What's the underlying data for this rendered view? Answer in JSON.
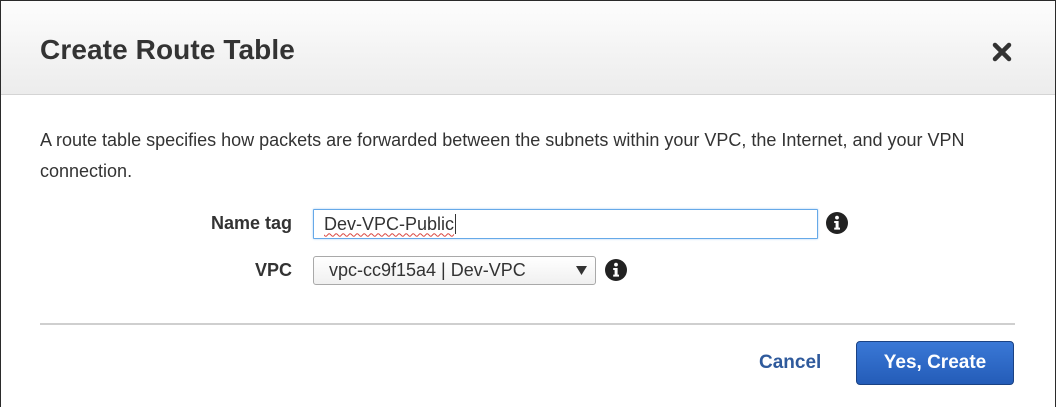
{
  "dialog": {
    "title": "Create Route Table",
    "close_icon": "close-icon",
    "description": "A route table specifies how packets are forwarded between the subnets within your VPC, the Internet, and your VPN connection."
  },
  "form": {
    "name_tag": {
      "label": "Name tag",
      "value": "Dev-VPC-Public",
      "info_icon": "info-icon"
    },
    "vpc": {
      "label": "VPC",
      "selected": "vpc-cc9f15a4 | Dev-VPC",
      "arrow": "▼",
      "info_icon": "info-icon"
    }
  },
  "actions": {
    "cancel_label": "Cancel",
    "create_label": "Yes, Create"
  },
  "colors": {
    "primary_button": "#2b63bf",
    "link": "#2f5a9c",
    "text": "#333333",
    "spellcheck_underline": "#d9453f"
  }
}
